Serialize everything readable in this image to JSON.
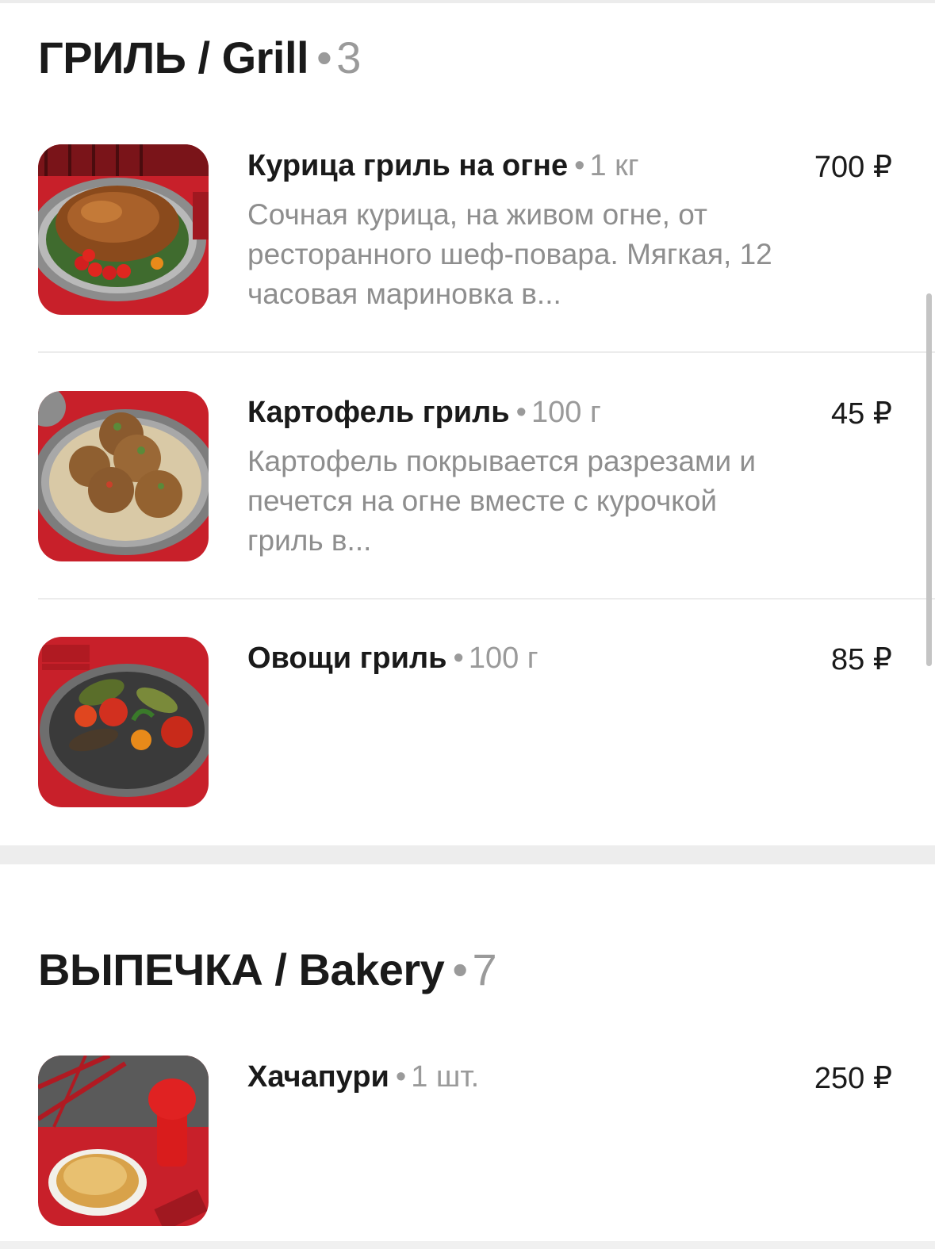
{
  "sections": [
    {
      "title": "ГРИЛЬ / Grill",
      "count": "3",
      "items": [
        {
          "name": "Курица гриль на огне",
          "weight": "1 кг",
          "price": "700 ₽",
          "description": "Сочная курица, на живом огне, от ресторанного шеф-повара. Мягкая, 12 часовая мариновка в...",
          "image": "grilled-chicken-photo"
        },
        {
          "name": "Картофель гриль",
          "weight": "100 г",
          "price": "45 ₽",
          "description": "Картофель покрывается разрезами и печется на огне вместе с курочкой гриль в...",
          "image": "grilled-potatoes-photo"
        },
        {
          "name": "Овощи гриль",
          "weight": "100 г",
          "price": "85 ₽",
          "description": "",
          "image": "grilled-vegetables-photo"
        }
      ]
    },
    {
      "title": "ВЫПЕЧКА / Bakery",
      "count": "7",
      "items": [
        {
          "name": "Хачапури",
          "weight": "1 шт.",
          "price": "250 ₽",
          "description": "",
          "image": "khachapuri-photo"
        }
      ]
    }
  ],
  "separator": "•",
  "colors": {
    "text": "#1a1a1a",
    "muted": "#9a9a9a",
    "description": "#8e8e8e",
    "divider": "#ececec",
    "food_background_red": "#c8202a"
  }
}
